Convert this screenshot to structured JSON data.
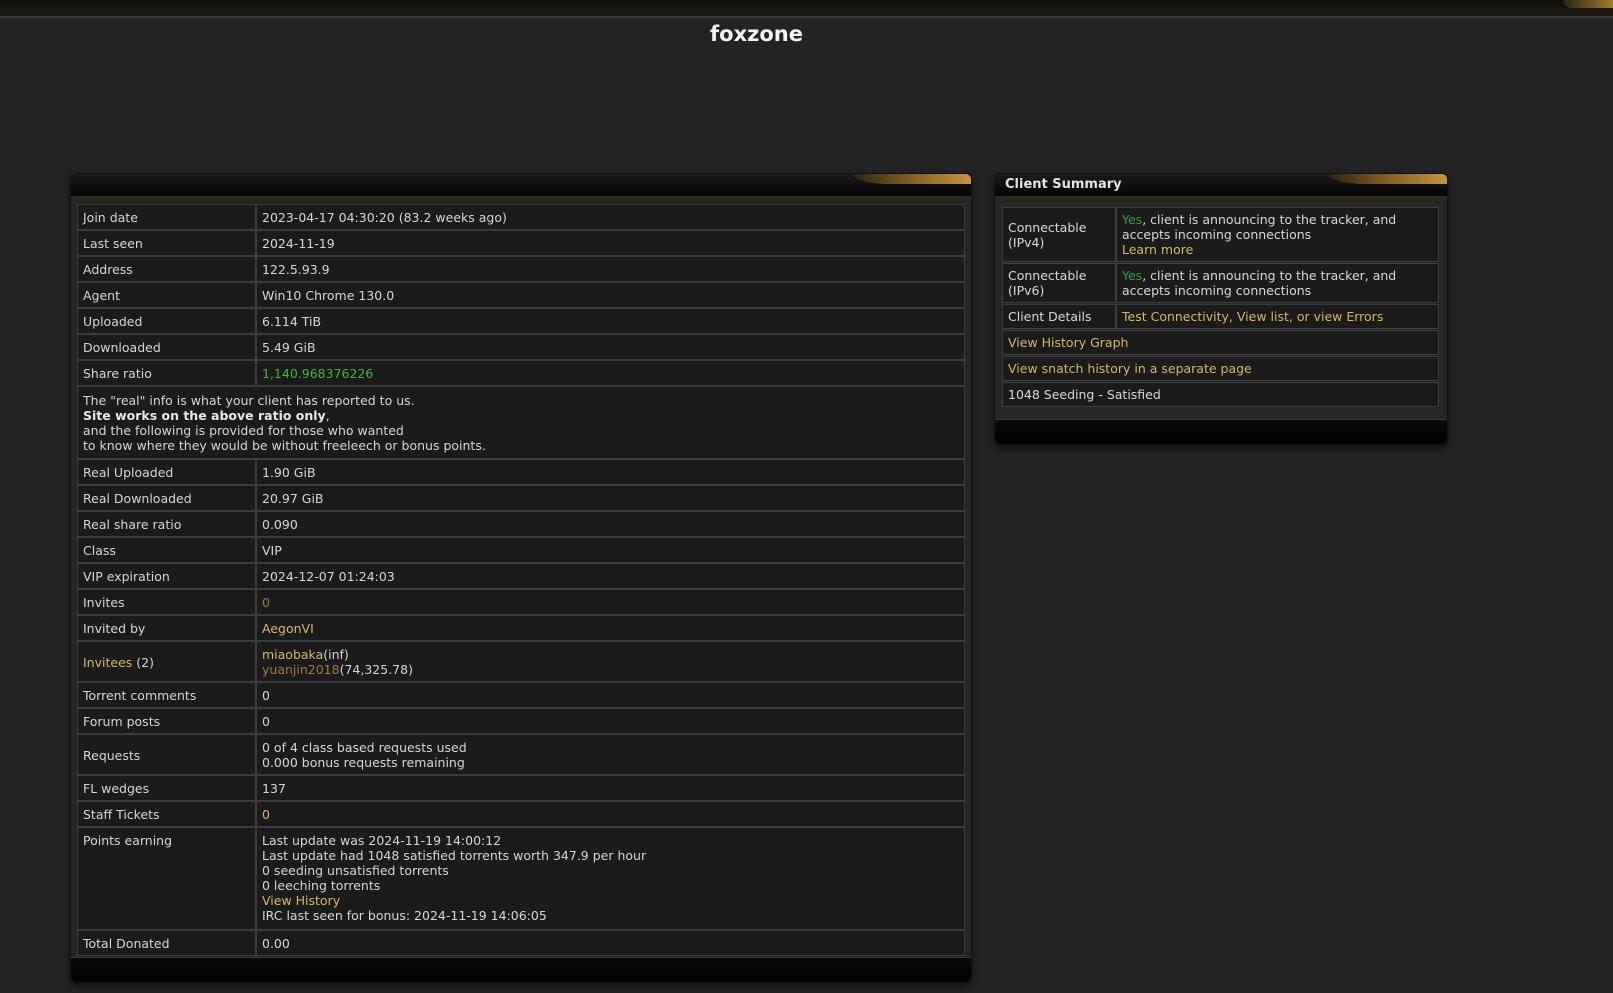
{
  "site": {
    "title": "foxzone"
  },
  "profile": {
    "rows": [
      {
        "label": "Join date",
        "value": "2023-04-17 04:30:20 (83.2 weeks ago)"
      },
      {
        "label": "Last seen",
        "value": "2024-11-19"
      },
      {
        "label": "Address",
        "value": "122.5.93.9"
      },
      {
        "label": "Agent",
        "value": "Win10 Chrome 130.0"
      },
      {
        "label": "Uploaded",
        "value": "6.114 TiB"
      },
      {
        "label": "Downloaded",
        "value": "5.49 GiB"
      },
      {
        "label": "Share ratio",
        "value": "1,140.968376226"
      }
    ],
    "notice": {
      "line1": "The \"real\" info is what your client has reported to us.",
      "line2_bold": "Site works on the above ratio only",
      "line2_tail": ",",
      "line3": "and the following is provided for those who wanted",
      "line4": "to know where they would be without freeleech or bonus points."
    },
    "real_rows": [
      {
        "label": "Real Uploaded",
        "value": "1.90 GiB"
      },
      {
        "label": "Real Downloaded",
        "value": "20.97 GiB"
      },
      {
        "label": "Real share ratio",
        "value": "0.090"
      },
      {
        "label": "Class",
        "value": "VIP"
      },
      {
        "label": "VIP expiration",
        "value": "2024-12-07 01:24:03"
      }
    ],
    "invites": {
      "label": "Invites",
      "value": "0"
    },
    "invited_by": {
      "label": "Invited by",
      "value": "AegonVI"
    },
    "invitees": {
      "label": "Invitees",
      "count": "(2)",
      "list": [
        {
          "name": "miaobaka",
          "ratio": "(inf)"
        },
        {
          "name": "yuanjin2018",
          "ratio": "(74,325.78)"
        }
      ]
    },
    "torrent_comments": {
      "label": "Torrent comments",
      "value": "0"
    },
    "forum_posts": {
      "label": "Forum posts",
      "value": "0"
    },
    "requests": {
      "label": "Requests",
      "line1": "0 of 4 class based requests used",
      "line2": "0.000 bonus requests remaining"
    },
    "fl_wedges": {
      "label": "FL wedges",
      "value": "137"
    },
    "staff_tickets": {
      "label": "Staff Tickets",
      "value": "0"
    },
    "points": {
      "label": "Points earning",
      "line1": "Last update was 2024-11-19 14:00:12",
      "line2": "Last update had 1048 satisfied torrents worth 347.9 per hour",
      "line3": "0 seeding unsatisfied torrents",
      "line4": "0 leeching torrents",
      "history_link": "View History",
      "line6": "IRC last seen for bonus: 2024-11-19 14:06:05"
    },
    "total_donated": {
      "label": "Total Donated",
      "value": "0.00"
    }
  },
  "client_summary": {
    "title": "Client Summary",
    "ipv4": {
      "label": "Connectable (IPv4)",
      "yes": "Yes",
      "text": ", client is announcing to the tracker, and accepts incoming connections",
      "learn_more": "Learn more"
    },
    "ipv6": {
      "label": "Connectable (IPv6)",
      "yes": "Yes",
      "text": ", client is announcing to the tracker, and accepts incoming connections"
    },
    "client_details": {
      "label": "Client Details",
      "test_link": "Test Connectivity",
      "sep1": ", ",
      "list_link": "View list",
      "sep2": ", or ",
      "errors_link": "view Errors"
    },
    "history_graph_link": "View History Graph",
    "snatch_link": "View snatch history in a separate page",
    "seeding_status": "1048 Seeding - Satisfied"
  },
  "colors": {
    "link_gold": "#d7b764",
    "ratio_green": "#3fb43f",
    "yes_green": "#3a9a3a",
    "accent_gold": "#c7943f"
  }
}
